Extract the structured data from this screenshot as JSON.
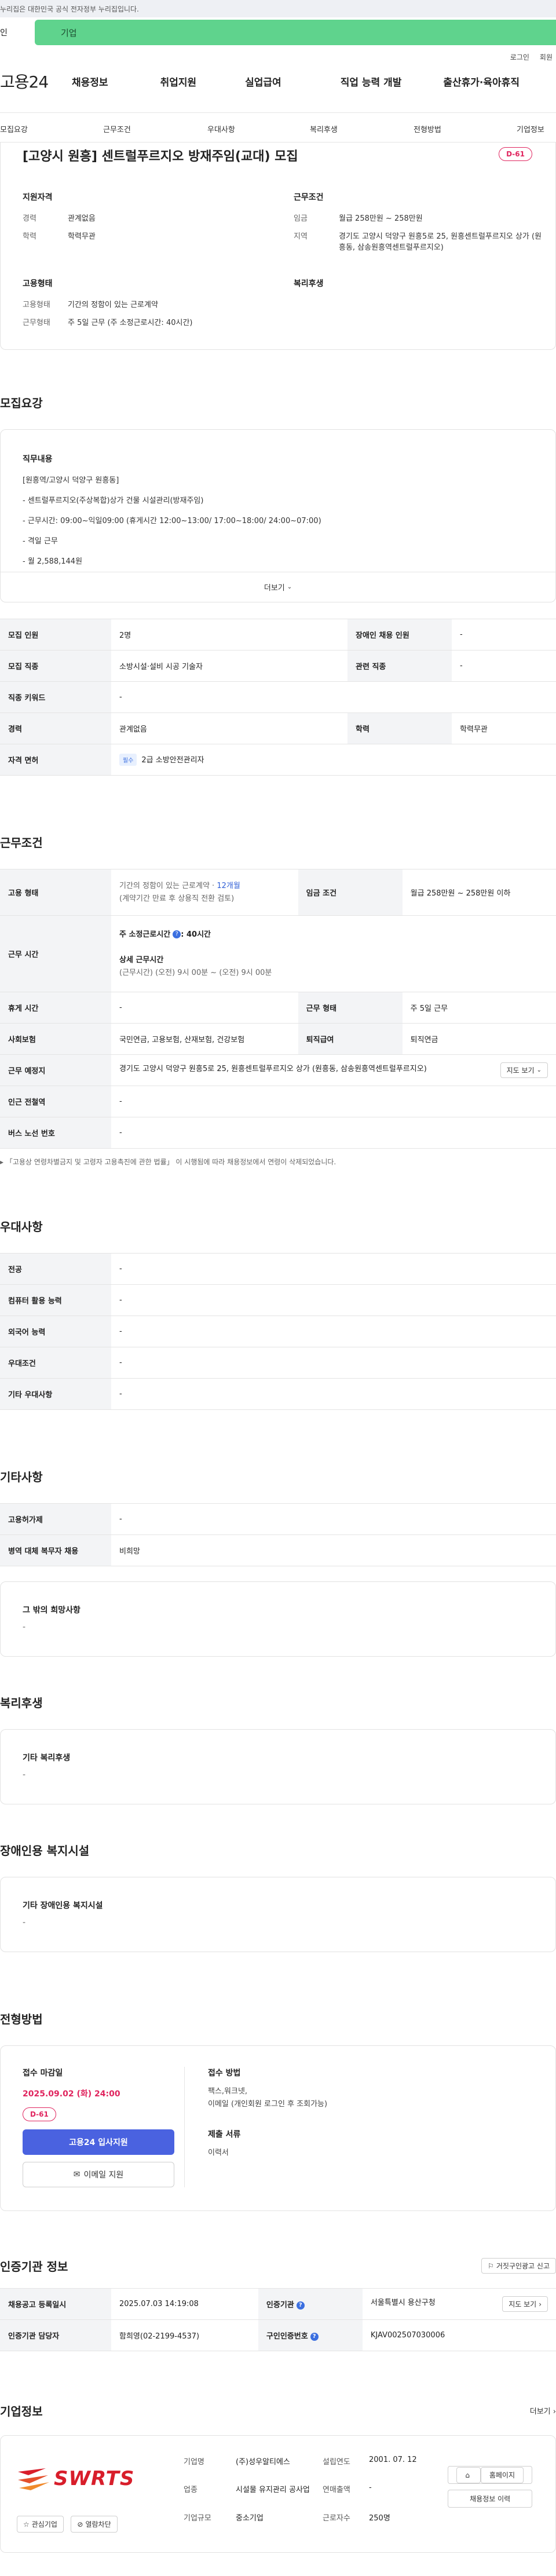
{
  "top_notice": "누리집은 대한민국 공식 전자정부 누리집입니다.",
  "gov_tabs": {
    "left": "인",
    "right": "기업"
  },
  "util": {
    "login": "로그인",
    "signup": "회원"
  },
  "logo": "고용24",
  "gnb": [
    "채용정보",
    "취업지원",
    "실업급여",
    "직업 능력 개발",
    "출산휴가·육아휴직"
  ],
  "subnav": [
    "모집요강",
    "근무조건",
    "우대사항",
    "복리후생",
    "전형방법",
    "기업정보"
  ],
  "title": {
    "text": "[고양시 원흥] 센트럴푸르지오 방재주임(교대) 모집",
    "dday": "D-61",
    "qual_heading": "지원자격",
    "qual": [
      {
        "k": "경력",
        "v": "관계없음"
      },
      {
        "k": "학력",
        "v": "학력무관"
      }
    ],
    "cond_heading": "근무조건",
    "cond": [
      {
        "k": "임금",
        "v": "월급 258만원 ~ 258만원"
      },
      {
        "k": "지역",
        "v": "경기도 고양시 덕양구 원흥5로 25, 원흥센트럴푸르지오 상가 (원흥동, 삼송원흥역센트럴푸르지오)"
      }
    ],
    "emp_heading": "고용형태",
    "emp": [
      {
        "k": "고용형태",
        "v": "기간의 정함이 있는 근로계약"
      },
      {
        "k": "근무형태",
        "v": "주 5일 근무 (주 소정근로시간: 40시간)"
      }
    ],
    "welfare_heading": "복리후생"
  },
  "recruit": {
    "section": "모집요강",
    "desc_head": "직무내용",
    "desc_lines": [
      "[원흥역/고양시 덕양구 원흥동]",
      "- 센트럴푸르지오(주상복합)상가 건물 시설관리(방재주임)",
      "- 근무시간: 09:00~익일09:00 (휴게시간 12:00~13:00/ 17:00~18:00/ 24:00~07:00)",
      "- 격일 근무",
      "- 월 2,588,144원"
    ],
    "more": "더보기",
    "rows": [
      {
        "k1": "모집 인원",
        "v1": "2명",
        "k2": "장애인 채용 인원",
        "v2": "-"
      },
      {
        "k1": "모집 직종",
        "v1": "소방시설·설비 시공 기술자",
        "k2": "관련 직종",
        "v2": "-"
      },
      {
        "k1": "직종 키워드",
        "v1": "-"
      },
      {
        "k1": "경력",
        "v1": "관계없음",
        "k2": "학력",
        "v2": "학력무관"
      }
    ],
    "license_k": "자격 면허",
    "license_badge": "필수",
    "license_v": "2급 소방안전관리자"
  },
  "work": {
    "section": "근무조건",
    "emp_type_k": "고용 형태",
    "emp_type_v1": "기간의 정함이 있는 근로계약 · ",
    "emp_type_months": "12개월",
    "emp_type_v2": "(계약기간 만료 후 상용직 전환 검토)",
    "wage_k": "임금 조건",
    "wage_v": "월급 258만원 ~ 258만원 이하",
    "hours_k": "근무 시간",
    "hours_week": "주 소정근로시간",
    "hours_week_v": ": 40시간",
    "hours_detail_h": "상세 근무시간",
    "hours_detail_v": "(근무시간) (오전) 9시 00분 ~ (오전) 9시 00분",
    "rest_k": "휴게 시간",
    "rest_v": "-",
    "form_k": "근무 형태",
    "form_v": "주 5일 근무",
    "ins_k": "사회보험",
    "ins_v": "국민연금, 고용보험, 산재보험, 건강보험",
    "sev_k": "퇴직급여",
    "sev_v": "퇴직연금",
    "place_k": "근무 예정지",
    "place_v": "경기도 고양시 덕양구 원흥5로 25, 원흥센트럴푸르지오 상가 (원흥동, 삼송원흥역센트럴푸르지오)",
    "map_btn": "지도 보기",
    "subway_k": "인근 전철역",
    "subway_v": "-",
    "bus_k": "버스 노선 번호",
    "bus_v": "-",
    "note": "「고용상 연령차별금지 및 고령자 고용촉진에 관한 법률」 이 시행됨에 따라 채용정보에서 연령이 삭제되었습니다."
  },
  "pref": {
    "section": "우대사항",
    "rows": [
      {
        "k": "전공",
        "v": "-"
      },
      {
        "k": "컴퓨터 활용 능력",
        "v": "-"
      },
      {
        "k": "외국어 능력",
        "v": "-"
      },
      {
        "k": "우대조건",
        "v": "-"
      },
      {
        "k": "기타 우대사항",
        "v": "-"
      }
    ]
  },
  "etc": {
    "section": "기타사항",
    "rows": [
      {
        "k": "고용허가제",
        "v": "-"
      },
      {
        "k": "병역 대체 복무자 채용",
        "v": "비희망"
      }
    ],
    "box_h": "그 밖의 희망사항",
    "box_v": "-"
  },
  "welfare": {
    "section": "복리후생",
    "box_h": "기타 복리후생",
    "box_v": "-"
  },
  "disabled": {
    "section": "장애인용 복지시설",
    "box_h": "기타 장애인용 복지시설",
    "box_v": "-"
  },
  "apply": {
    "section": "전형방법",
    "deadline_h": "접수 마감일",
    "deadline": "2025.09.02 (화) 24:00",
    "dday": "D-61",
    "primary": "고용24 입사지원",
    "email": "이메일 지원",
    "method_h": "접수 방법",
    "method_v": "팩스,워크넷,",
    "method_v2": "이메일 (개인회원 로그인 후 조회가능)",
    "docs_h": "제출 서류",
    "docs_v": "이력서"
  },
  "cert": {
    "section": "인증기관 정보",
    "report": "거짓구인광고 신고",
    "r1k1": "채용공고 등록일시",
    "r1v1": "2025.07.03 14:19:08",
    "r1k2": "인증기관",
    "r1v2": "서울특별시 용산구청",
    "map_btn": "지도 보기",
    "r2k1": "인증기관 담당자",
    "r2v1": "함희영(02-2199-4537)",
    "r2k2": "구인인증번호",
    "r2v2": "KJAV002507030006"
  },
  "company": {
    "section": "기업정보",
    "more": "더보기",
    "logo_text": "SWRTS",
    "fav": "관심기업",
    "block": "열람차단",
    "info": [
      {
        "k": "기업명",
        "v": "(주)성우알티에스",
        "k2": "설립연도",
        "v2": "2001. 07. 12"
      },
      {
        "k": "업종",
        "v": "시설물 유지관리 공사업",
        "k2": "연매출액",
        "v2": "-"
      },
      {
        "k": "기업규모",
        "v": "중소기업",
        "k2": "근로자수",
        "v2": "250명"
      }
    ],
    "home_btn": "홈페이지",
    "jobs_btn": "채용정보 이력"
  }
}
